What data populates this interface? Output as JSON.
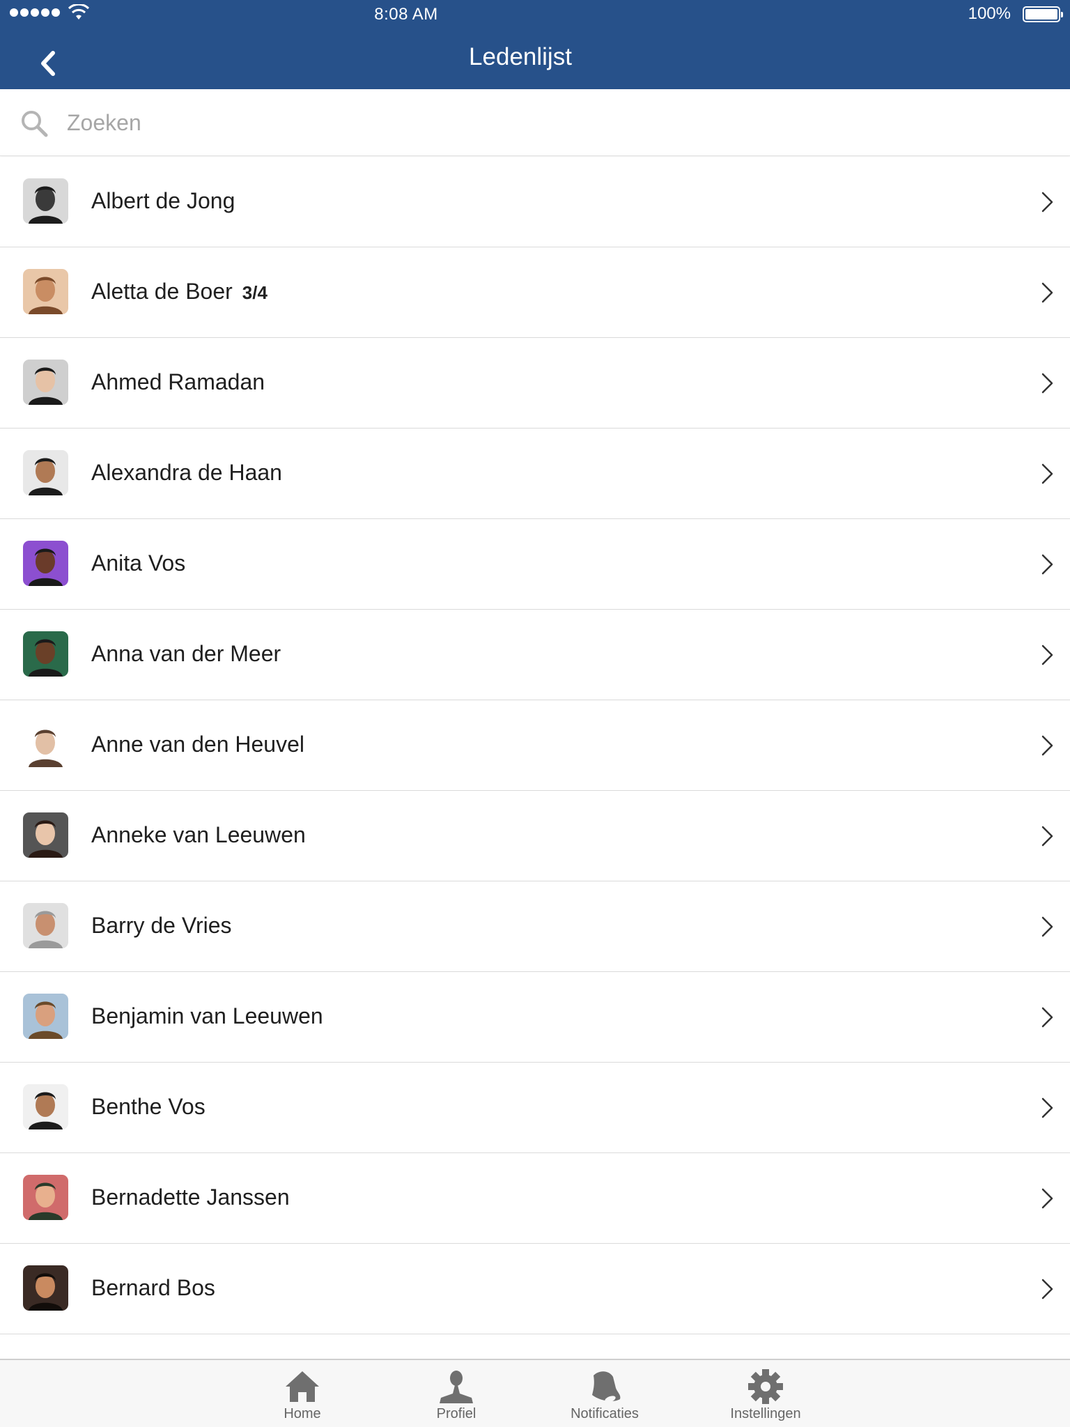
{
  "status_bar": {
    "time": "8:08 AM",
    "battery": "100%"
  },
  "nav": {
    "title": "Ledenlijst"
  },
  "search": {
    "placeholder": "Zoeken",
    "value": ""
  },
  "members": [
    {
      "name": "Albert de Jong",
      "badge": ""
    },
    {
      "name": "Aletta de Boer",
      "badge": "3/4"
    },
    {
      "name": "Ahmed Ramadan",
      "badge": ""
    },
    {
      "name": "Alexandra de Haan",
      "badge": ""
    },
    {
      "name": "Anita Vos",
      "badge": ""
    },
    {
      "name": "Anna van der Meer",
      "badge": ""
    },
    {
      "name": "Anne van den Heuvel",
      "badge": ""
    },
    {
      "name": "Anneke van Leeuwen",
      "badge": ""
    },
    {
      "name": "Barry de Vries",
      "badge": ""
    },
    {
      "name": "Benjamin van Leeuwen",
      "badge": ""
    },
    {
      "name": "Benthe Vos",
      "badge": ""
    },
    {
      "name": "Bernadette Janssen",
      "badge": ""
    },
    {
      "name": "Bernard Bos",
      "badge": ""
    }
  ],
  "tabbar": {
    "items": [
      {
        "label": "Home",
        "icon": "home-icon"
      },
      {
        "label": "Profiel",
        "icon": "person-icon"
      },
      {
        "label": "Notificaties",
        "icon": "bell-icon"
      },
      {
        "label": "Instellingen",
        "icon": "gear-icon"
      }
    ]
  },
  "colors": {
    "header": "#27518a",
    "tabbar_background": "#f7f7f7",
    "tab_icon": "#6f6f6f"
  }
}
